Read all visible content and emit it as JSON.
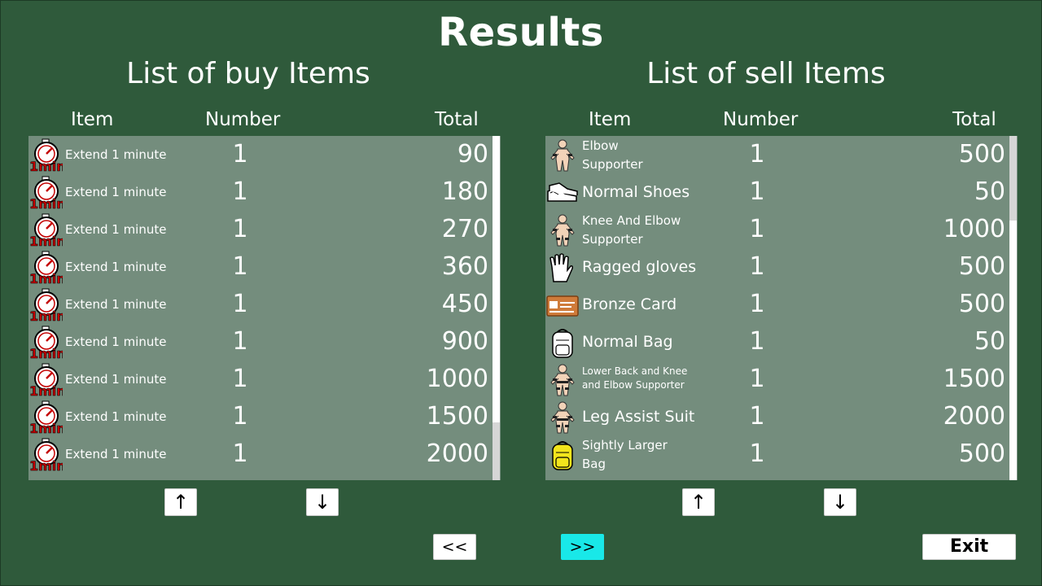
{
  "title": "Results",
  "buy": {
    "title": "List of buy Items",
    "headers": {
      "item": "Item",
      "number": "Number",
      "total": "Total"
    },
    "rows": [
      {
        "name": "Extend 1 minute",
        "number": "1",
        "total": "90",
        "icon": "timer-1min-icon"
      },
      {
        "name": "Extend 1 minute",
        "number": "1",
        "total": "180",
        "icon": "timer-1min-icon"
      },
      {
        "name": "Extend 1 minute",
        "number": "1",
        "total": "270",
        "icon": "timer-1min-icon"
      },
      {
        "name": "Extend 1 minute",
        "number": "1",
        "total": "360",
        "icon": "timer-1min-icon"
      },
      {
        "name": "Extend 1 minute",
        "number": "1",
        "total": "450",
        "icon": "timer-1min-icon"
      },
      {
        "name": "Extend 1 minute",
        "number": "1",
        "total": "900",
        "icon": "timer-1min-icon"
      },
      {
        "name": "Extend 1 minute",
        "number": "1",
        "total": "1000",
        "icon": "timer-1min-icon"
      },
      {
        "name": "Extend 1 minute",
        "number": "1",
        "total": "1500",
        "icon": "timer-1min-icon"
      },
      {
        "name": "Extend 1 minute",
        "number": "1",
        "total": "2000",
        "icon": "timer-1min-icon"
      }
    ],
    "up_label": "↑",
    "down_label": "↓"
  },
  "sell": {
    "title": "List of sell Items",
    "headers": {
      "item": "Item",
      "number": "Number",
      "total": "Total"
    },
    "rows": [
      {
        "name": "Elbow\nSupporter",
        "number": "1",
        "total": "500",
        "icon": "elbow-supporter-icon"
      },
      {
        "name": "Normal Shoes",
        "number": "1",
        "total": "50",
        "icon": "shoes-icon"
      },
      {
        "name": "Knee And Elbow\nSupporter",
        "number": "1",
        "total": "1000",
        "icon": "knee-elbow-supporter-icon"
      },
      {
        "name": "Ragged gloves",
        "number": "1",
        "total": "500",
        "icon": "gloves-icon"
      },
      {
        "name": "Bronze Card",
        "number": "1",
        "total": "500",
        "icon": "bronze-card-icon"
      },
      {
        "name": "Normal Bag",
        "number": "1",
        "total": "50",
        "icon": "backpack-icon"
      },
      {
        "name": "Lower Back and Knee\nand Elbow Supporter",
        "number": "1",
        "total": "1500",
        "icon": "body-supporter-icon"
      },
      {
        "name": "Leg Assist Suit",
        "number": "1",
        "total": "2000",
        "icon": "leg-assist-suit-icon"
      },
      {
        "name": "Sightly Larger\nBag",
        "number": "1",
        "total": "500",
        "icon": "yellow-backpack-icon"
      }
    ],
    "up_label": "↑",
    "down_label": "↓"
  },
  "nav": {
    "prev_label": "<<",
    "next_label": ">>",
    "exit_label": "Exit"
  },
  "colors": {
    "background": "#2f5a3b",
    "list_bg": "#748d7d",
    "highlight": "#19e8e8"
  }
}
